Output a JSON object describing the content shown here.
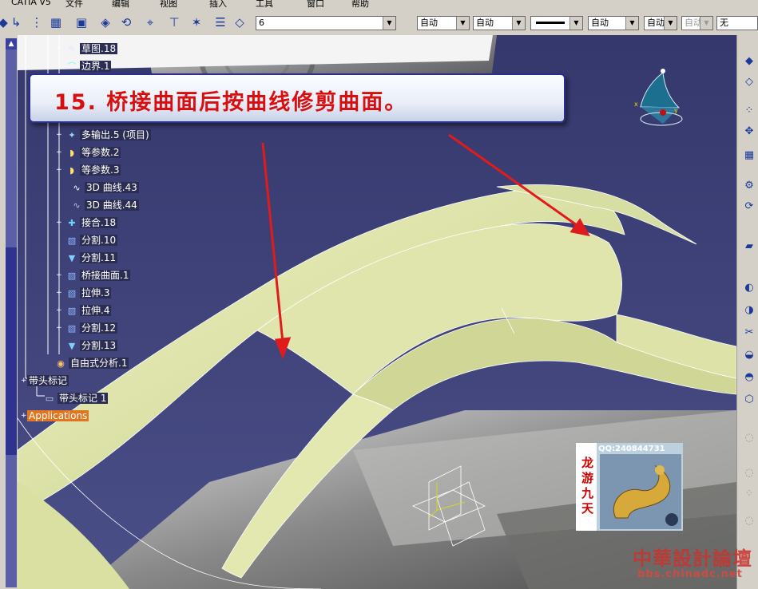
{
  "menubar": {
    "items": [
      "CATIA V5",
      "文件",
      "编辑",
      "视图",
      "插入",
      "工具",
      "窗口",
      "帮助"
    ]
  },
  "toolbar": {
    "layer_value": "6",
    "combos": [
      "自动",
      "自动",
      "",
      "自动",
      "自动",
      "自动",
      "无"
    ],
    "disabled_combo": "自动"
  },
  "tree": {
    "nodes": [
      {
        "label": "草图.18",
        "icon": "sketch-icon"
      },
      {
        "label": "边界.1",
        "icon": "boundary-icon"
      },
      {
        "label": "多输出.5 (项目)",
        "icon": "multi-output-icon"
      },
      {
        "label": "等参数.2",
        "icon": "isoparametric-icon"
      },
      {
        "label": "等参数.3",
        "icon": "isoparametric-icon"
      },
      {
        "label": "3D 曲线.43",
        "icon": "curve-3d-icon"
      },
      {
        "label": "3D 曲线.44",
        "icon": "curve-3d-icon"
      },
      {
        "label": "接合.18",
        "icon": "join-icon"
      },
      {
        "label": "分割.10",
        "icon": "split-icon"
      },
      {
        "label": "分割.11",
        "icon": "split-icon"
      },
      {
        "label": "桥接曲面.1",
        "icon": "blend-surface-icon"
      },
      {
        "label": "拉伸.3",
        "icon": "extrude-icon"
      },
      {
        "label": "拉伸.4",
        "icon": "extrude-icon"
      },
      {
        "label": "分割.12",
        "icon": "split-icon"
      },
      {
        "label": "分割.13",
        "icon": "split-icon"
      },
      {
        "label": "自由式分析.1",
        "icon": "freestyle-analysis-icon"
      },
      {
        "label": "带头标记",
        "icon": ""
      },
      {
        "label": "带头标记 1",
        "icon": "annotation-icon"
      },
      {
        "label": "Applications",
        "icon": ""
      }
    ]
  },
  "banner": {
    "text": "15. 桥接曲面后按曲线修剪曲面。"
  },
  "logo": {
    "qq": "QQ:240844731",
    "side_text": "龙游九天"
  },
  "watermark": {
    "cn": "中華設計論壇",
    "url": "bbs.chinadc.net"
  },
  "colors": {
    "surface": "#dbe2a6",
    "background": "#3e4178",
    "arrow": "#e01b1b",
    "highlight": "#e2751f"
  }
}
